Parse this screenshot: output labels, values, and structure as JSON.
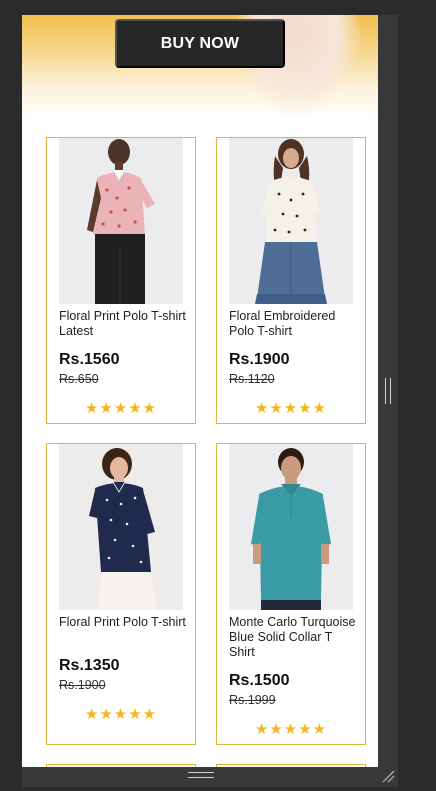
{
  "banner": {
    "cta_label": "BUY NOW"
  },
  "products": [
    {
      "name": "Floral Print Polo T-shirt Latest",
      "price": "Rs.1560",
      "mrp": "Rs.650",
      "stars": "★★★★★",
      "rating": 5
    },
    {
      "name": "Floral Embroidered Polo T-shirt",
      "price": "Rs.1900",
      "mrp": "Rs.1120",
      "stars": "★★★★★",
      "rating": 5
    },
    {
      "name": "Floral Print Polo T-shirt",
      "price": "Rs.1350",
      "mrp": "Rs.1900",
      "stars": "★★★★★",
      "rating": 5
    },
    {
      "name": "Monte Carlo Turquoise Blue Solid Collar T Shirt",
      "price": "Rs.1500",
      "mrp": "Rs.1999",
      "stars": "★★★★★",
      "rating": 5
    }
  ],
  "colors": {
    "accent_border": "#e0b33a",
    "star": "#f4b51f",
    "button_bg": "#272727",
    "banner_top": "#f1c050",
    "frame": "#383838"
  }
}
